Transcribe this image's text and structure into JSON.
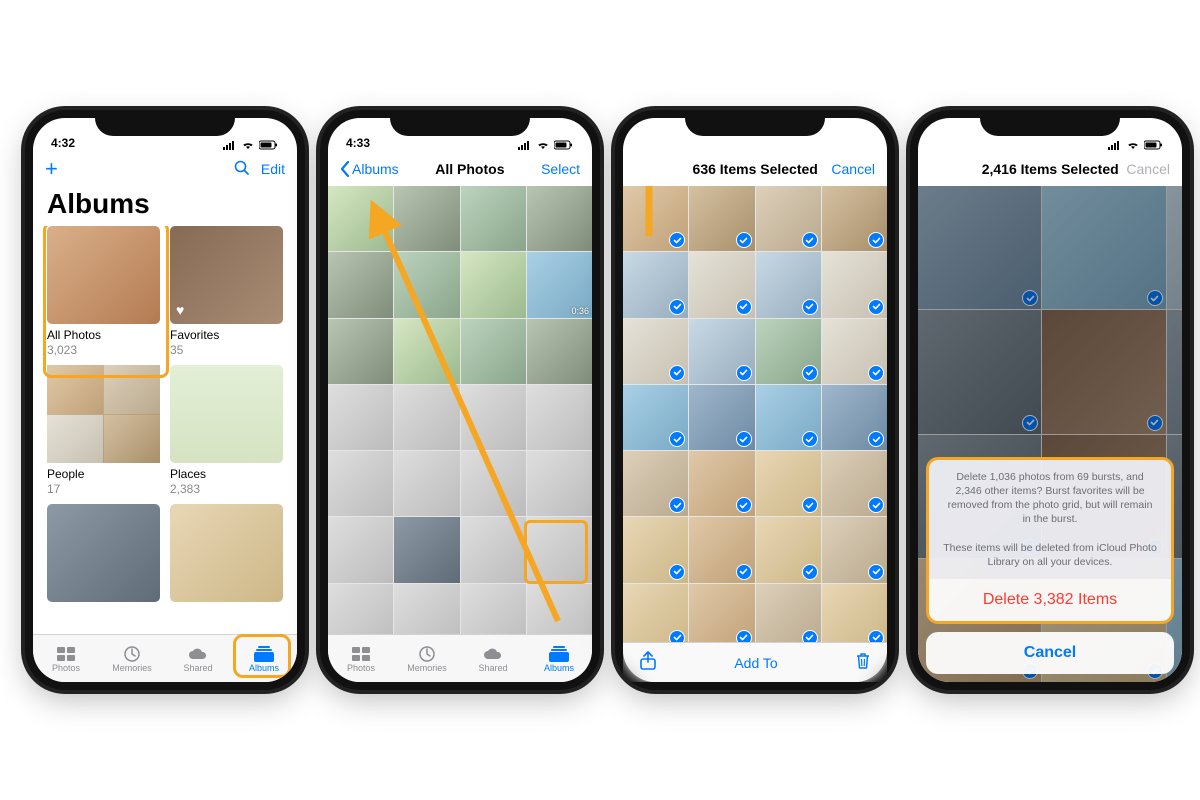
{
  "highlight_color": "#f5a623",
  "ios_blue": "#007aff",
  "tabs": [
    {
      "label": "Photos",
      "icon": "photos-icon"
    },
    {
      "label": "Memories",
      "icon": "memories-icon"
    },
    {
      "label": "Shared",
      "icon": "cloud-icon"
    },
    {
      "label": "Albums",
      "icon": "albums-icon"
    }
  ],
  "phone1": {
    "time": "4:32",
    "nav": {
      "edit": "Edit"
    },
    "large_title": "Albums",
    "albums": [
      {
        "name": "All Photos",
        "count": "3,023"
      },
      {
        "name": "Favorites",
        "count": "35"
      },
      {
        "name": "People",
        "count": "17"
      },
      {
        "name": "Places",
        "count": "2,383"
      }
    ]
  },
  "phone2": {
    "time": "4:33",
    "nav": {
      "back": "Albums",
      "title": "All Photos",
      "select": "Select"
    },
    "video_duration": "0:36"
  },
  "phone3": {
    "nav": {
      "title": "636 Items Selected",
      "cancel": "Cancel"
    },
    "toolbar": {
      "add_to": "Add To"
    }
  },
  "phone4": {
    "nav": {
      "title": "2,416 Items Selected",
      "cancel": "Cancel"
    },
    "sheet": {
      "message": "Delete 1,036 photos from 69 bursts, and 2,346 other items? Burst favorites will be removed from the photo grid, but will remain in the burst.\n\nThese items will be deleted from iCloud Photo Library on all your devices.",
      "delete": "Delete 3,382 Items",
      "cancel": "Cancel"
    }
  }
}
